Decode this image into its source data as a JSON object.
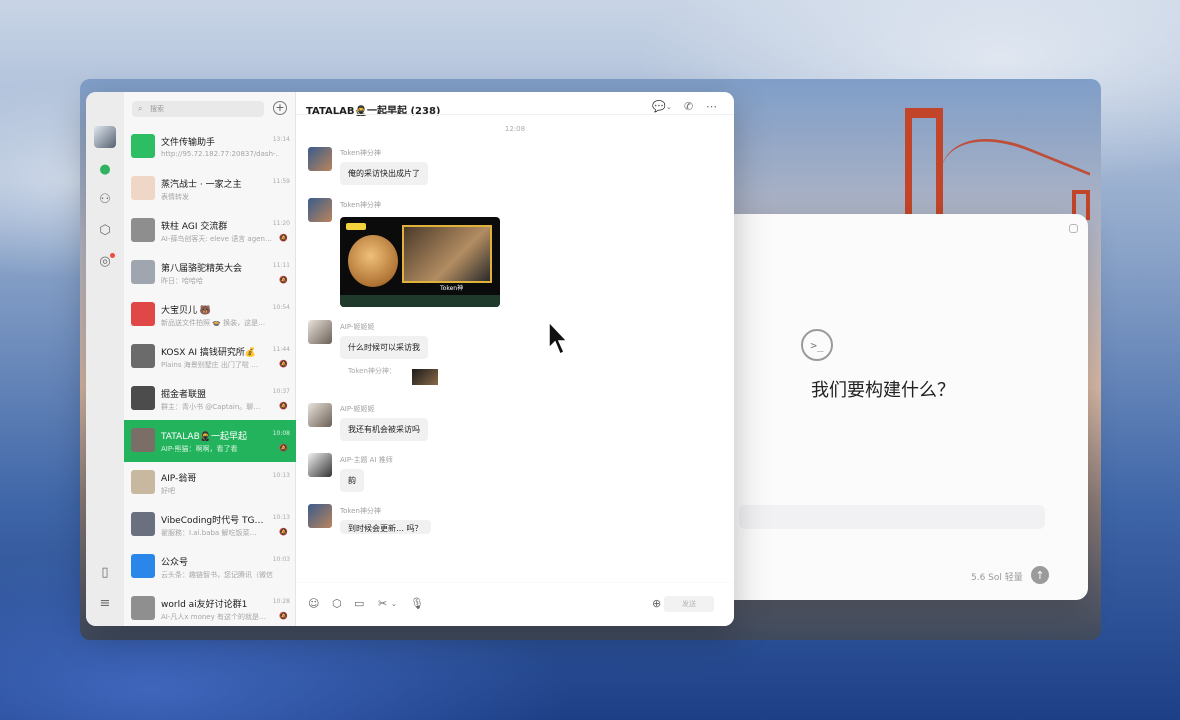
{
  "wechat": {
    "search_placeholder": "搜索",
    "add_icon": "+",
    "conversations": [
      {
        "name": "文件传输助手",
        "time": "13:14",
        "preview": "http://95.72.182.77:20837/dash-…",
        "color": "#2dbe64",
        "muted": false
      },
      {
        "name": "蒸汽战士 · 一家之主",
        "time": "11:59",
        "preview": "表情转发",
        "color": "#f0d6c6",
        "muted": false
      },
      {
        "name": "轶柱 AGI 交流群",
        "time": "11:20",
        "preview": "AI-薛鸟创客天: eleve 语言 agen…",
        "color": "#8e8e8e",
        "muted": true
      },
      {
        "name": "第八届骆驼精英大会",
        "time": "11:11",
        "preview": "昨日：哈哈哈",
        "color": "#a0a6b0",
        "muted": true
      },
      {
        "name": "大宝贝儿 🐻",
        "time": "10:54",
        "preview": "新品送文件拍照 🍲 换装，这是…",
        "color": "#e04848",
        "muted": false
      },
      {
        "name": "KOSX AI 搞钱研究所💰",
        "time": "11:44",
        "preview": "Plains 海景别墅庄 出门了啦 …",
        "color": "#6b6b6b",
        "muted": true
      },
      {
        "name": "掘金者联盟",
        "time": "10:37",
        "preview": "群主：青小书 @Captain。聊…",
        "color": "#4c4c4c",
        "muted": true
      },
      {
        "name": "TATALAB🥷一起早起",
        "time": "10:08",
        "preview": "AIP-熊猫：啊啊，看了看",
        "color": "#7a6e66",
        "muted": true
      },
      {
        "name": "AIP-翁哥",
        "time": "10:13",
        "preview": "好吧",
        "color": "#c9b8a0",
        "muted": false
      },
      {
        "name": "VibeCoding时代号 TG…",
        "time": "10:13",
        "preview": "翟服務：I.ai.baba 解吃饭菜…",
        "color": "#6a7080",
        "muted": true
      },
      {
        "name": "公众号",
        "time": "10:03",
        "preview": "云头条：趣链智书，您记腾讯（微信",
        "color": "#2a86e8",
        "muted": false
      },
      {
        "name": "world ai友好讨论群1",
        "time": "10:28",
        "preview": "AI-凡人x money 有这个的就是…",
        "color": "#8f8f8f",
        "muted": true
      }
    ],
    "active_index": 7
  },
  "chat": {
    "title": "TATALAB🥷一起早起 (238)",
    "timestamp": "12:08",
    "messages": [
      {
        "sender": "Token神分神",
        "text": "俺的采访快出成片了"
      },
      {
        "sender": "Token神分神",
        "image_label": "Token神"
      },
      {
        "sender": "AIP-姬姬姬",
        "text": "什么时候可以采访我"
      },
      {
        "quote": "Token神分神："
      },
      {
        "sender": "AIP-姬姬姬",
        "text": "我还有机会被采访吗"
      },
      {
        "sender": "AIP-主题 AI 推师",
        "text": "韵"
      },
      {
        "sender": "Token神分神",
        "text": "到时候会更新… 吗？"
      }
    ],
    "send_label": "发送"
  },
  "assistant": {
    "heading": "我们要构建什么？",
    "model_label": "5.6 Sol 轻量",
    "logo": ">_"
  },
  "colors": {
    "accent": "#23b35c"
  }
}
